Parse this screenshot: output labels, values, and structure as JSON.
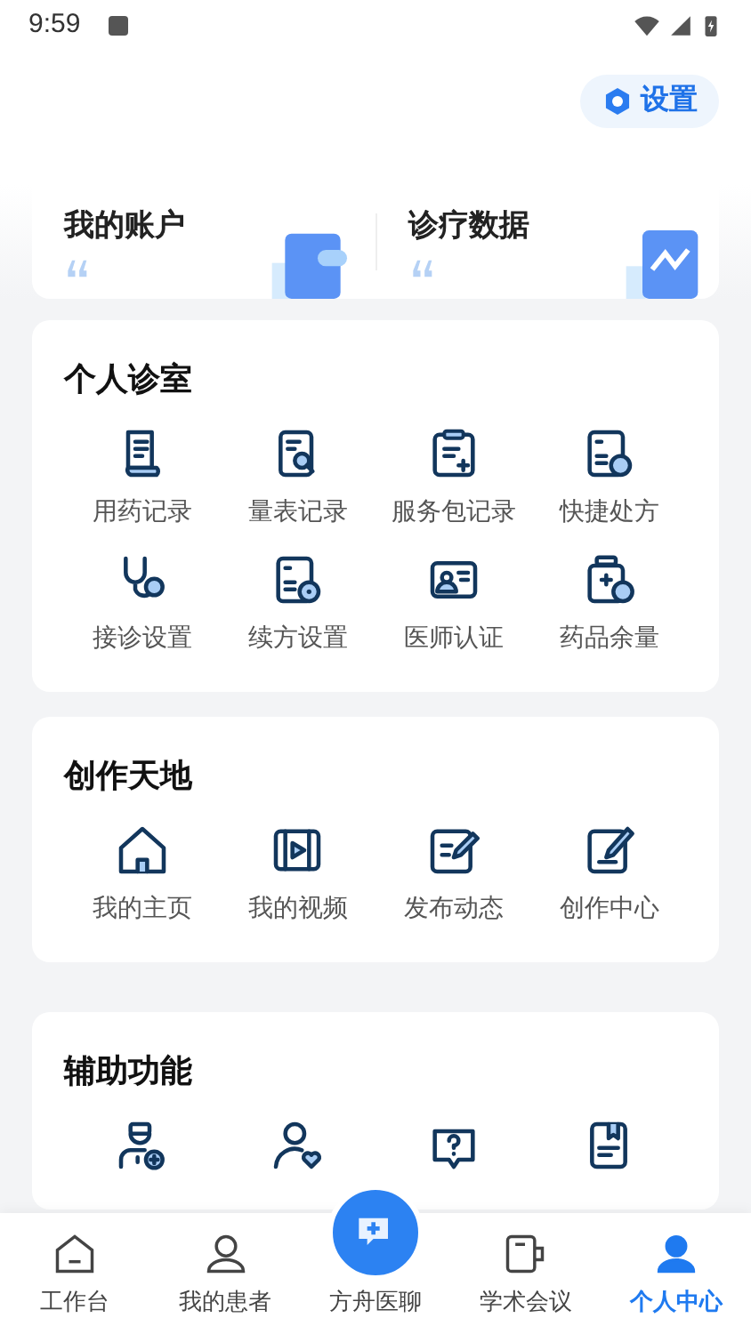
{
  "status_bar": {
    "time": "9:59"
  },
  "settings_button": {
    "label": "设置"
  },
  "account_cards": [
    {
      "title": "我的账户"
    },
    {
      "title": "诊疗数据"
    }
  ],
  "sections": [
    {
      "title": "个人诊室",
      "items": [
        {
          "label": "用药记录"
        },
        {
          "label": "量表记录"
        },
        {
          "label": "服务包记录"
        },
        {
          "label": "快捷处方"
        },
        {
          "label": "接诊设置"
        },
        {
          "label": "续方设置"
        },
        {
          "label": "医师认证"
        },
        {
          "label": "药品余量"
        }
      ]
    },
    {
      "title": "创作天地",
      "items": [
        {
          "label": "我的主页"
        },
        {
          "label": "我的视频"
        },
        {
          "label": "发布动态"
        },
        {
          "label": "创作中心"
        }
      ]
    },
    {
      "title": "辅助功能",
      "items": [
        {
          "kind": "icon_only"
        },
        {
          "kind": "icon_only"
        },
        {
          "kind": "icon_only"
        },
        {
          "kind": "icon_only"
        }
      ]
    }
  ],
  "tab_bar": [
    {
      "label": "工作台",
      "selected": false
    },
    {
      "label": "我的患者",
      "selected": false
    },
    {
      "label": "方舟医聊",
      "selected": false,
      "kind": "center"
    },
    {
      "label": "学术会议",
      "selected": false
    },
    {
      "label": "个人中心",
      "selected": true
    }
  ]
}
